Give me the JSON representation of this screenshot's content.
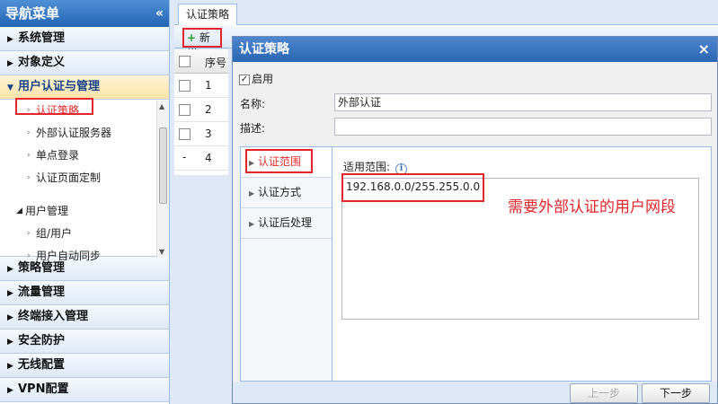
{
  "sidebar": {
    "title": "导航菜单",
    "collapse_icon": "«",
    "categories_top": [
      {
        "label": "系统管理"
      },
      {
        "label": "对象定义"
      }
    ],
    "open_category": {
      "label": "用户认证与管理"
    },
    "sub_items": [
      {
        "label": "认证策略",
        "selected": true
      },
      {
        "label": "外部认证服务器"
      },
      {
        "label": "单点登录"
      },
      {
        "label": "认证页面定制"
      }
    ],
    "group": {
      "label": "用户管理"
    },
    "group_items": [
      {
        "label": "组/用户"
      },
      {
        "label": "用户自动同步"
      }
    ],
    "categories_bottom": [
      {
        "label": "策略管理"
      },
      {
        "label": "流量管理"
      },
      {
        "label": "终端接入管理"
      },
      {
        "label": "安全防护"
      },
      {
        "label": "无线配置"
      },
      {
        "label": "VPN配置"
      }
    ]
  },
  "main": {
    "tab_label": "认证策略",
    "toolbar": {
      "add_label": "新增"
    },
    "grid": {
      "header": "序号",
      "rows": [
        "1",
        "2",
        "3",
        "4"
      ]
    }
  },
  "dialog": {
    "title": "认证策略",
    "close": "×",
    "enable_label": "启用",
    "name_label": "名称:",
    "name_value": "外部认证",
    "desc_label": "描述:",
    "desc_value": "",
    "tabs": [
      {
        "label": "认证范围",
        "active": true
      },
      {
        "label": "认证方式"
      },
      {
        "label": "认证后处理"
      }
    ],
    "range_label": "适用范围:",
    "range_value": "192.168.0.0/255.255.0.0",
    "annotation": "需要外部认证的用户网段",
    "prev_label": "上一步",
    "next_label": "下一步"
  },
  "colors": {
    "highlight": "#e3262b",
    "header_blue": "#2465b3"
  }
}
